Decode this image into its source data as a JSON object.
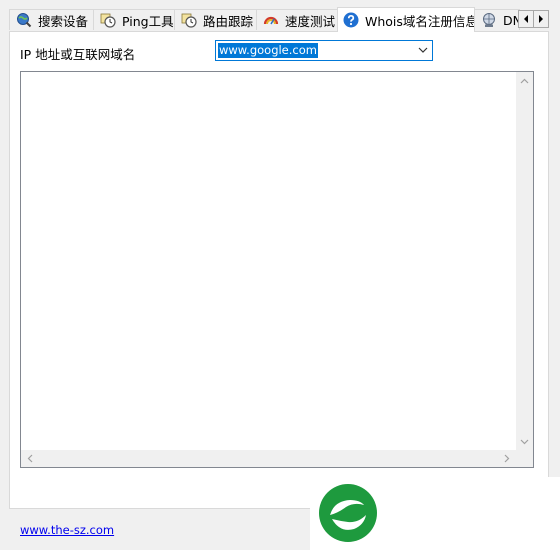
{
  "tabs": [
    {
      "label": "搜索设备",
      "icon": "globe-search-icon"
    },
    {
      "label": "Ping工具",
      "icon": "ping-clock-icon"
    },
    {
      "label": "路由跟踪",
      "icon": "traceroute-clock-icon"
    },
    {
      "label": "速度测试",
      "icon": "speed-gauge-icon"
    },
    {
      "label": "Whois域名注册信息",
      "icon": "help-question-icon",
      "active": true
    },
    {
      "label": "DN",
      "icon": "dns-globe-icon"
    }
  ],
  "form": {
    "address_label": "IP 地址或互联网域名",
    "address_value": "www.google.com"
  },
  "footer": {
    "link": "www.the-sz.com"
  },
  "colors": {
    "accent": "#0078d7",
    "logo_green": "#1e9a3e"
  }
}
